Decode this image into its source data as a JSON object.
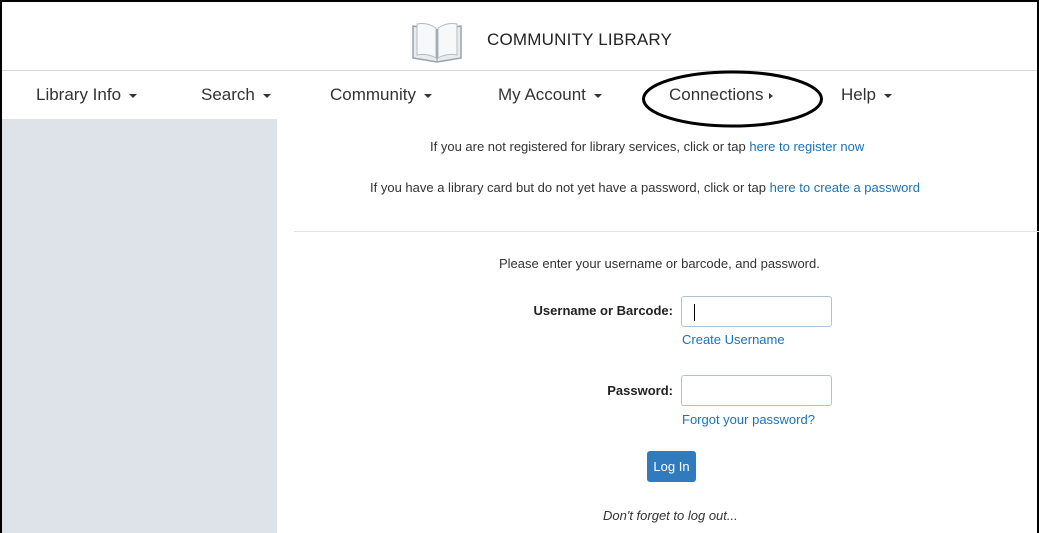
{
  "header": {
    "logo_icon": "open-book-icon",
    "title": "COMMUNITY LIBRARY"
  },
  "nav": {
    "items": [
      {
        "label": "Library Info",
        "indicator": "caret-down"
      },
      {
        "label": "Search",
        "indicator": "caret-down"
      },
      {
        "label": "Community",
        "indicator": "caret-down"
      },
      {
        "label": "My Account",
        "indicator": "caret-down"
      },
      {
        "label": "Connections",
        "indicator": "caret-right",
        "highlighted": true
      },
      {
        "label": "Help",
        "indicator": "caret-down"
      }
    ]
  },
  "notices": {
    "register_text": "If you are not registered for library services, click or tap",
    "register_link": "here to register now",
    "password_text": "If you have a library card but do not yet have a password, click or tap",
    "password_link": "here to create a password"
  },
  "login": {
    "instructions": "Please enter your username or barcode, and password.",
    "username_label": "Username or Barcode:",
    "username_value": "",
    "create_username_link": "Create Username",
    "password_label": "Password:",
    "password_value": "",
    "forgot_password_link": "Forgot your password?",
    "login_button": "Log In",
    "reminder": "Don't forget to log out..."
  },
  "colors": {
    "link": "#1a73b8",
    "button": "#2f7bbd",
    "sidebar": "#dde3e8",
    "highlight_ellipse": "#000000"
  }
}
